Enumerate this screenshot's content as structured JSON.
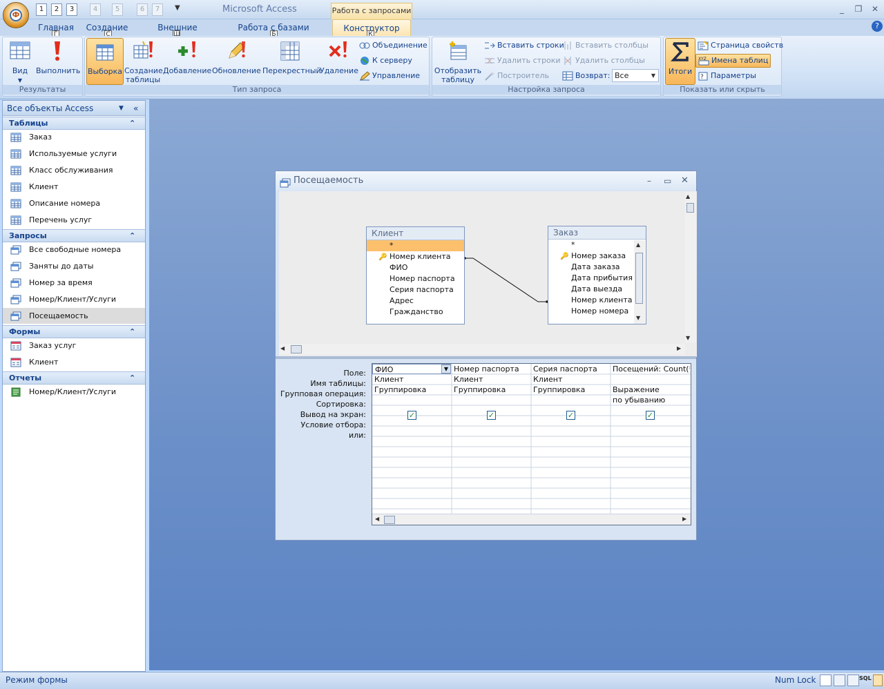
{
  "app": {
    "title": "Microsoft Access",
    "context_tab_title": "Работа с запросами",
    "office_button_label": "Ф"
  },
  "qat": {
    "items": [
      "1",
      "2",
      "3",
      "4",
      "5",
      "6",
      "7"
    ]
  },
  "tabs": [
    {
      "label": "Главная",
      "keytip": "Г"
    },
    {
      "label": "Создание",
      "keytip": "С"
    },
    {
      "label": "Внешние данные",
      "keytip": "Ш"
    },
    {
      "label": "Работа с базами данных",
      "keytip": "Б"
    },
    {
      "label": "Конструктор",
      "keytip": "К"
    }
  ],
  "ribbon": {
    "results": {
      "label": "Результаты",
      "view": "Вид",
      "run": "Выполнить"
    },
    "query_type": {
      "label": "Тип запроса",
      "select": "Выборка",
      "make_table_1": "Создание",
      "make_table_2": "таблицы",
      "append": "Добавление",
      "update": "Обновление",
      "crosstab": "Перекрестный",
      "delete": "Удаление",
      "union": "Объединение",
      "pass_through": "К серверу",
      "data_definition": "Управление"
    },
    "setup": {
      "label": "Настройка запроса",
      "show_table_1": "Отобразить",
      "show_table_2": "таблицу",
      "insert_rows": "Вставить строки",
      "delete_rows": "Удалить строки",
      "builder": "Построитель",
      "insert_columns": "Вставить столбцы",
      "delete_columns": "Удалить столбцы",
      "return_label": "Возврат:",
      "return_value": "Все"
    },
    "show_hide": {
      "label": "Показать или скрыть",
      "totals": "Итоги",
      "property_sheet": "Страница свойств",
      "table_names": "Имена таблиц",
      "parameters": "Параметры"
    }
  },
  "nav": {
    "header": "Все объекты Access",
    "tables_label": "Таблицы",
    "tables": [
      "Заказ",
      "Используемые услуги",
      "Класс обслуживания",
      "Клиент",
      "Описание номера",
      "Перечень услуг"
    ],
    "queries_label": "Запросы",
    "queries": [
      "Все свободные номера",
      "Заняты до даты",
      "Номер за время",
      "Номер/Клиент/Услуги",
      "Посещаемость"
    ],
    "forms_label": "Формы",
    "forms": [
      "Заказ услуг",
      "Клиент"
    ],
    "reports_label": "Отчеты",
    "reports": [
      "Номер/Клиент/Услуги"
    ]
  },
  "query_window": {
    "title": "Посещаемость",
    "table_client": {
      "name": "Клиент",
      "fields": [
        "*",
        "Номер клиента",
        "ФИО",
        "Номер паспорта",
        "Серия паспорта",
        "Адрес",
        "Гражданство"
      ]
    },
    "table_order": {
      "name": "Заказ",
      "fields": [
        "*",
        "Номер заказа",
        "Дата заказа",
        "Дата прибытия",
        "Дата выезда",
        "Номер клиента",
        "Номер номера"
      ]
    },
    "row_labels": [
      "Поле:",
      "Имя таблицы:",
      "Групповая операция:",
      "Сортировка:",
      "Вывод на экран:",
      "Условие отбора:",
      "или:"
    ],
    "columns": [
      {
        "field": "ФИО",
        "table": "Клиент",
        "total": "Группировка",
        "sort": "",
        "show": true
      },
      {
        "field": "Номер паспорта",
        "table": "Клиент",
        "total": "Группировка",
        "sort": "",
        "show": true
      },
      {
        "field": "Серия паспорта",
        "table": "Клиент",
        "total": "Группировка",
        "sort": "",
        "show": true
      },
      {
        "field": "Посещений: Count(*)",
        "table": "",
        "total": "Выражение",
        "sort": "по убыванию",
        "show": true
      }
    ]
  },
  "status": {
    "left": "Режим формы",
    "numlock": "Num Lock"
  }
}
